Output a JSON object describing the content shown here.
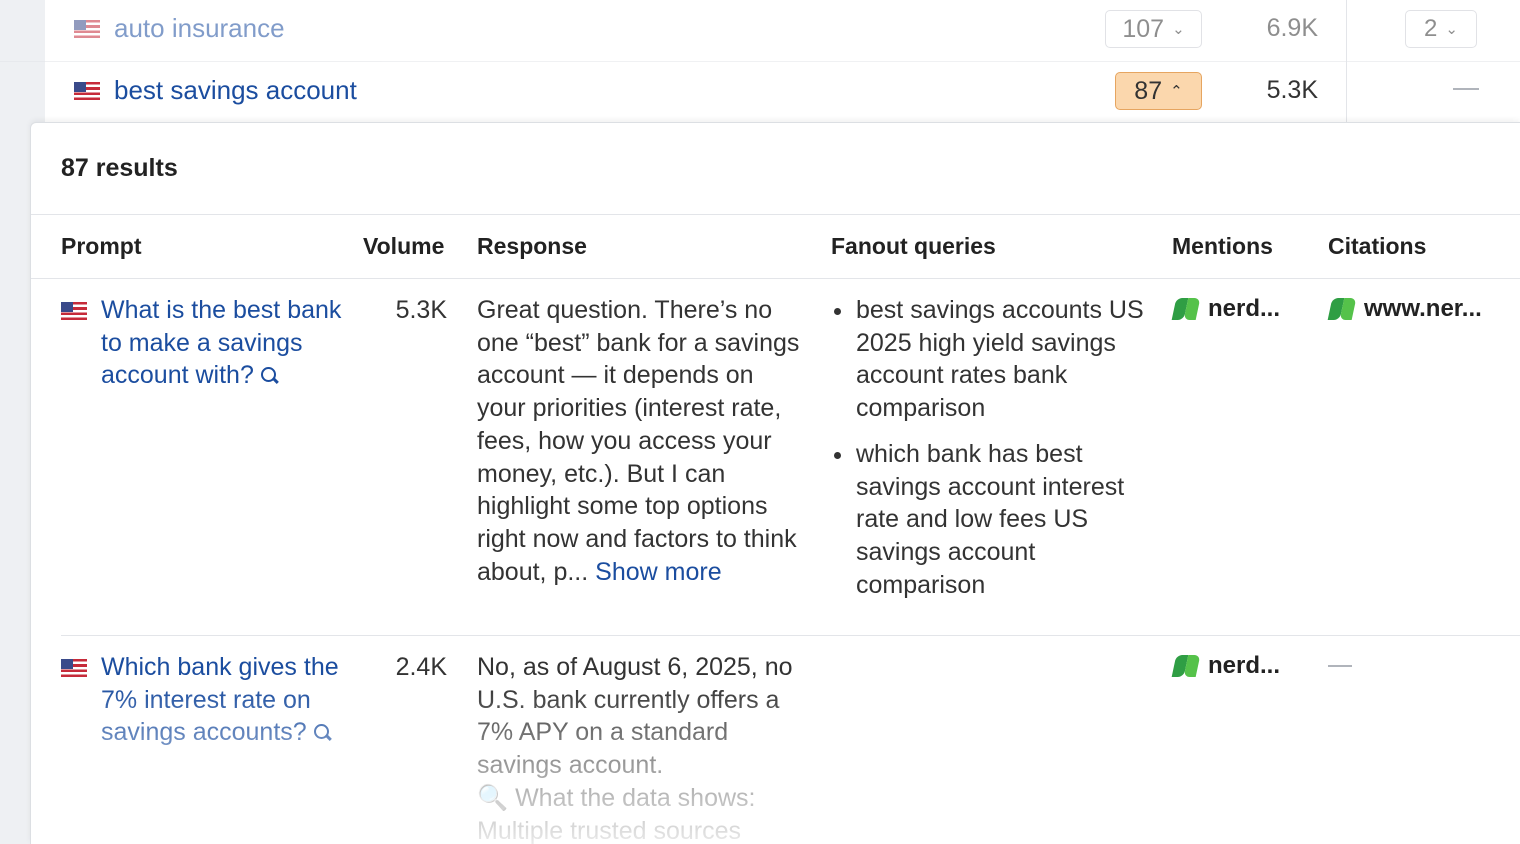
{
  "keyword_rows": [
    {
      "keyword": "auto insurance",
      "count": "107",
      "volume": "6.9K",
      "extra": "2"
    },
    {
      "keyword": "best savings account",
      "count": "87",
      "volume": "5.3K",
      "extra": "—"
    }
  ],
  "popup": {
    "title": "87 results",
    "columns": [
      "Prompt",
      "Volume",
      "Response",
      "Fanout queries",
      "Mentions",
      "Citations"
    ],
    "rows": [
      {
        "prompt": "What is the best bank to make a savings account with?",
        "volume": "5.3K",
        "response": "Great question. There’s no one “best” bank for a savings account — it depends on your priorities (interest rate, fees, how you access your money, etc.). But I can highlight some top options right now and factors to think about, p...",
        "show_more": "Show more",
        "fanout": [
          "best savings accounts US 2025 high yield savings account rates bank comparison",
          "which bank has best savings account interest rate and low fees US savings account comparison"
        ],
        "mention": "nerd...",
        "citation": "www.ner..."
      },
      {
        "prompt": "Which bank gives the 7% interest rate on savings accounts?",
        "volume": "2.4K",
        "response": "No, as of August 6, 2025, no U.S. bank currently offers a 7% APY on a standard savings account.",
        "response_line2": "🔍 What the data shows:",
        "response_line3": "Multiple trusted sources",
        "mention": "nerd...",
        "citation": "—"
      }
    ]
  },
  "icons": {
    "flag": "us-flag-icon",
    "search": "search-icon",
    "brand": "nerdwallet-logo-icon",
    "chevron_down": "chevron-down-icon",
    "chevron_up": "chevron-up-icon"
  },
  "colors": {
    "link": "#1b4d9f",
    "active_badge": "#fbd7ad",
    "active_badge_border": "#e6a560"
  }
}
